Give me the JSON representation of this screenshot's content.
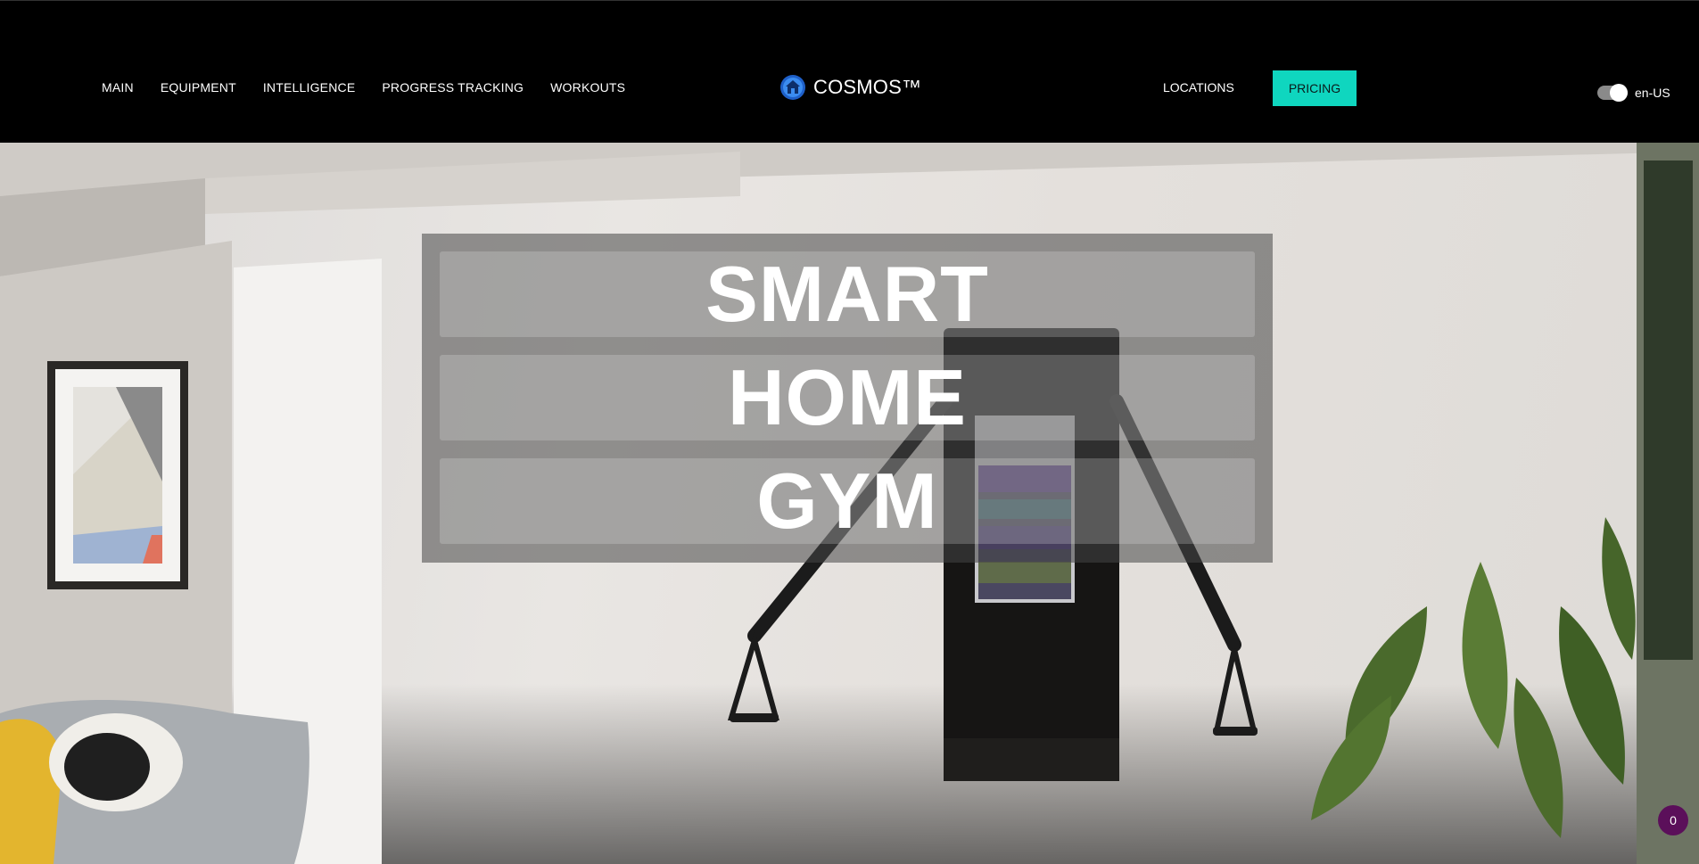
{
  "nav": {
    "items": [
      {
        "label": "MAIN"
      },
      {
        "label": "EQUIPMENT"
      },
      {
        "label": "INTELLIGENCE"
      },
      {
        "label": "PROGRESS TRACKING"
      },
      {
        "label": "WORKOUTS"
      }
    ],
    "locations": "LOCATIONS",
    "pricing": "PRICING"
  },
  "brand": {
    "name": "COSMOS™",
    "icon": "home-icon",
    "icon_color": "#2f7be0"
  },
  "language": {
    "label": "en-US",
    "toggle_on": true
  },
  "hero": {
    "lines": [
      "SMART",
      "HOME",
      "GYM"
    ]
  },
  "badge": {
    "count": "0",
    "color": "#5b0f5a"
  },
  "colors": {
    "accent": "#0fd6bf",
    "header_bg": "#000000"
  }
}
